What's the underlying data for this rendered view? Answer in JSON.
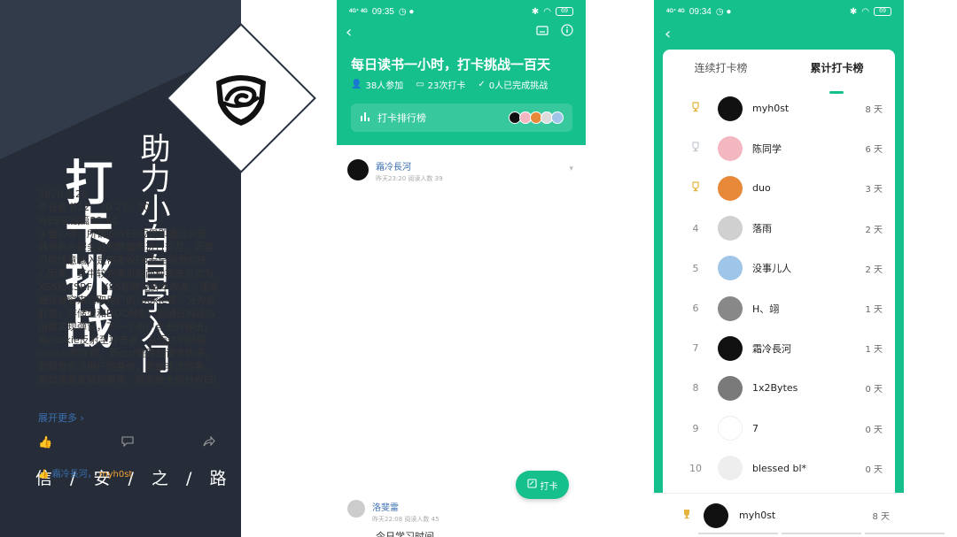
{
  "left_panel": {
    "title": "打卡挑战",
    "subtitle": "助力小白自学入门",
    "slogan": "信 / 安 / 之 / 路",
    "logo_icon": "spiral-shield-logo"
  },
  "status_bar_left": {
    "time": "09:35",
    "signal": "4G⁺ 4G"
  },
  "status_bar_right": {
    "time": "09:34",
    "signal": "4G⁺ 4G"
  },
  "battery": "69",
  "challenge": {
    "title": "每日读书一小时，打卡挑战一百天",
    "participants": "38人参加",
    "checkins": "23次打卡",
    "completed": "0人已完成挑战",
    "ranking_label": "打卡排行榜"
  },
  "post": {
    "author": "霜冷長河",
    "meta": "昨天23:20  阅读人数 39",
    "lines": [
      "2020.9.28",
      "今日看书22：30-23：30",
      "WEB实战篇30-61",
      "主要心得：所谓的WEB应用即通过浏览",
      "器对后台服务器和数据库进行交互，而用",
      "户的任意输入是带来WEB安全隐患的核",
      "心因素。其中较为常见的两种攻击方式为",
      "XSS和CSRF。XSS即跨站脚本攻击，通常",
      "通过弹窗来窃取用户的cookie等，分为反",
      "射型，存储型和DOOM型，即通过构造JS",
      "函数实现弹窗，下一个用户点击时弹出，",
      "将cookie反射至攻击者，从而达到获取",
      "cookie的作用。而csrf是跨站请求伪造，",
      "即假借合法用户的身份，去做非法的事。",
      "例如恶意发帖刷屏等。目前绝大部分WEB"
    ],
    "expand": "展开更多 ›",
    "like_icon": "thumbs-up-icon",
    "comment_icon": "comment-icon",
    "share_icon": "share-icon",
    "liked_by_1": "霜冷長河，",
    "liked_by_2": "myh0st"
  },
  "checkin_button": "打卡",
  "post2": {
    "author": "洛斐雷",
    "meta": "昨天22:08  阅读人数 45",
    "preview": "今日学习时间"
  },
  "ranking": {
    "tab_consecutive": "连续打卡榜",
    "tab_total": "累计打卡榜",
    "rows": [
      {
        "rank": "1",
        "name": "myh0st",
        "value": "8 天",
        "color": "#111111",
        "trophy": "gold"
      },
      {
        "rank": "2",
        "name": "陈同学",
        "value": "6 天",
        "color": "#f4b6c0",
        "trophy": "silver"
      },
      {
        "rank": "3",
        "name": "duo",
        "value": "3 天",
        "color": "#e8893a",
        "trophy": "bronze"
      },
      {
        "rank": "4",
        "name": "落雨",
        "value": "2 天",
        "color": "#d0d0d0",
        "trophy": ""
      },
      {
        "rank": "5",
        "name": "没事儿人",
        "value": "2 天",
        "color": "#9fc5e8",
        "trophy": ""
      },
      {
        "rank": "6",
        "name": "H、翊",
        "value": "1 天",
        "color": "#888888",
        "trophy": ""
      },
      {
        "rank": "7",
        "name": "霜冷長河",
        "value": "1 天",
        "color": "#111111",
        "trophy": ""
      },
      {
        "rank": "8",
        "name": "1x2Bytes",
        "value": "0 天",
        "color": "#7a7a7a",
        "trophy": ""
      },
      {
        "rank": "9",
        "name": "7",
        "value": "0 天",
        "color": "#ffffff",
        "trophy": ""
      },
      {
        "rank": "10",
        "name": "blessed bl*",
        "value": "0 天",
        "color": "#eeeeee",
        "trophy": ""
      }
    ],
    "me": {
      "name": "myh0st",
      "value": "8 天"
    }
  },
  "colors": {
    "accent": "#15c08c",
    "panel": "#262d39",
    "gold": "#e6b33e",
    "silver": "#c4c9d0",
    "link": "#3a6fb0"
  }
}
